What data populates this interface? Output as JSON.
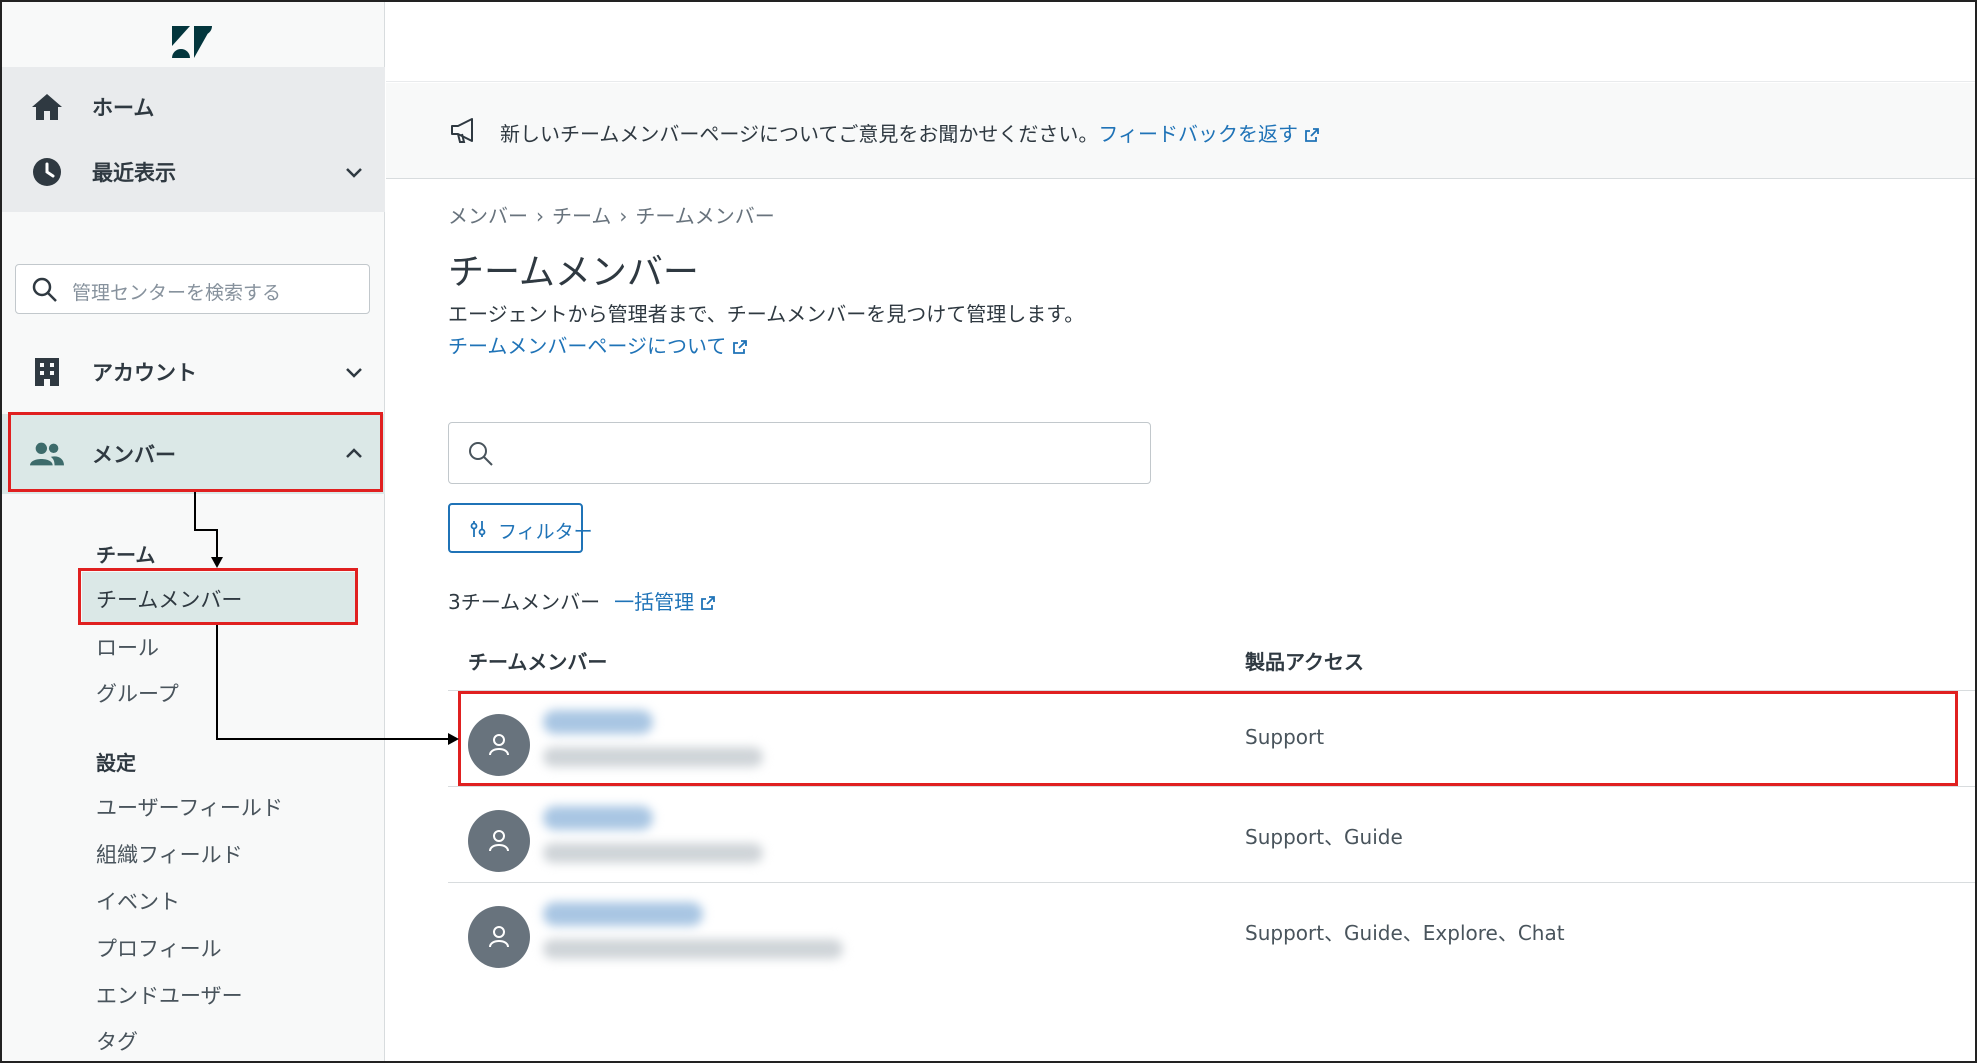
{
  "sidebar": {
    "home": "ホーム",
    "recent": "最近表示",
    "search_placeholder": "管理センターを検索する",
    "account": "アカウント",
    "members": "メンバー",
    "team_heading": "チーム",
    "team_items": [
      "チームメンバー",
      "ロール",
      "グループ"
    ],
    "settings_heading": "設定",
    "settings_items": [
      "ユーザーフィールド",
      "組織フィールド",
      "イベント",
      "プロフィール",
      "エンドユーザー",
      "タグ"
    ]
  },
  "banner": {
    "message": "新しいチームメンバーページについてご意見をお聞かせください。",
    "link": "フィードバックを返す"
  },
  "breadcrumb": [
    "メンバー",
    "チーム",
    "チームメンバー"
  ],
  "page": {
    "title": "チームメンバー",
    "description": "エージェントから管理者まで、チームメンバーを見つけて管理します。",
    "about_link": "チームメンバーページについて",
    "filter_label": "フィルター",
    "count_label": "3チームメンバー",
    "bulk_link": "一括管理"
  },
  "table": {
    "columns": [
      "チームメンバー",
      "製品アクセス"
    ],
    "rows": [
      {
        "access": "Support"
      },
      {
        "access": "Support、Guide"
      },
      {
        "access": "Support、Guide、Explore、Chat"
      }
    ]
  },
  "colors": {
    "accent": "#1f73b7",
    "highlight": "#e02020",
    "active_bg": "#dbe8e7",
    "avatar": "#68737d"
  }
}
